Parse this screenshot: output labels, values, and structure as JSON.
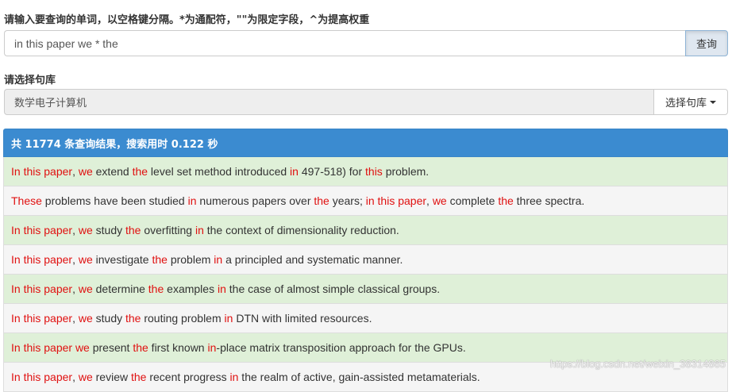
{
  "query": {
    "label": "请输入要查询的单词，以空格键分隔。*为通配符，\"\"为限定字段，^为提高权重",
    "value": "in this paper we * the",
    "button": "查询"
  },
  "corpus": {
    "label": "请选择句库",
    "selected": "数学电子计算机",
    "button": "选择句库"
  },
  "results": {
    "header": "共 11774 条查询结果，搜索用时 0.122 秒",
    "highlight_color": "#e01010",
    "success_row_color": "#dff0d8",
    "plain_row_color": "#f5f5f5",
    "rows": [
      {
        "style": "success",
        "segments": [
          {
            "t": "In this paper",
            "h": true
          },
          {
            "t": ", ",
            "h": false
          },
          {
            "t": "we",
            "h": true
          },
          {
            "t": " extend ",
            "h": false
          },
          {
            "t": "the",
            "h": true
          },
          {
            "t": " level set method introduced ",
            "h": false
          },
          {
            "t": "in",
            "h": true
          },
          {
            "t": " 497-518) for ",
            "h": false
          },
          {
            "t": "this",
            "h": true
          },
          {
            "t": " problem.",
            "h": false
          }
        ]
      },
      {
        "style": "plain",
        "segments": [
          {
            "t": "These",
            "h": true
          },
          {
            "t": " problems have been studied ",
            "h": false
          },
          {
            "t": "in",
            "h": true
          },
          {
            "t": " numerous papers over ",
            "h": false
          },
          {
            "t": "the",
            "h": true
          },
          {
            "t": " years; ",
            "h": false
          },
          {
            "t": "in this paper",
            "h": true
          },
          {
            "t": ", ",
            "h": false
          },
          {
            "t": "we",
            "h": true
          },
          {
            "t": " complete ",
            "h": false
          },
          {
            "t": "the",
            "h": true
          },
          {
            "t": " three spectra.",
            "h": false
          }
        ]
      },
      {
        "style": "success",
        "segments": [
          {
            "t": "In this paper",
            "h": true
          },
          {
            "t": ", ",
            "h": false
          },
          {
            "t": "we",
            "h": true
          },
          {
            "t": " study ",
            "h": false
          },
          {
            "t": "the",
            "h": true
          },
          {
            "t": " overfitting ",
            "h": false
          },
          {
            "t": "in",
            "h": true
          },
          {
            "t": " the context of dimensionality reduction.",
            "h": false
          }
        ]
      },
      {
        "style": "plain",
        "segments": [
          {
            "t": "In this paper",
            "h": true
          },
          {
            "t": ", ",
            "h": false
          },
          {
            "t": "we",
            "h": true
          },
          {
            "t": " investigate ",
            "h": false
          },
          {
            "t": "the",
            "h": true
          },
          {
            "t": " problem ",
            "h": false
          },
          {
            "t": "in",
            "h": true
          },
          {
            "t": " a principled and systematic manner.",
            "h": false
          }
        ]
      },
      {
        "style": "success",
        "segments": [
          {
            "t": "In this paper",
            "h": true
          },
          {
            "t": ", ",
            "h": false
          },
          {
            "t": "we",
            "h": true
          },
          {
            "t": " determine ",
            "h": false
          },
          {
            "t": "the",
            "h": true
          },
          {
            "t": " examples ",
            "h": false
          },
          {
            "t": "in",
            "h": true
          },
          {
            "t": " the case of almost simple classical groups.",
            "h": false
          }
        ]
      },
      {
        "style": "plain",
        "segments": [
          {
            "t": "In this paper",
            "h": true
          },
          {
            "t": ", ",
            "h": false
          },
          {
            "t": "we",
            "h": true
          },
          {
            "t": " study ",
            "h": false
          },
          {
            "t": "the",
            "h": true
          },
          {
            "t": " routing problem ",
            "h": false
          },
          {
            "t": "in",
            "h": true
          },
          {
            "t": " DTN with limited resources.",
            "h": false
          }
        ]
      },
      {
        "style": "success",
        "segments": [
          {
            "t": "In this paper we",
            "h": true
          },
          {
            "t": " present ",
            "h": false
          },
          {
            "t": "the",
            "h": true
          },
          {
            "t": " first known ",
            "h": false
          },
          {
            "t": "in",
            "h": true
          },
          {
            "t": "-place matrix transposition approach for the GPUs.",
            "h": false
          }
        ]
      },
      {
        "style": "plain",
        "segments": [
          {
            "t": "In this paper",
            "h": true
          },
          {
            "t": ", ",
            "h": false
          },
          {
            "t": "we",
            "h": true
          },
          {
            "t": " review ",
            "h": false
          },
          {
            "t": "the",
            "h": true
          },
          {
            "t": " recent progress ",
            "h": false
          },
          {
            "t": "in",
            "h": true
          },
          {
            "t": " the realm of active, gain-assisted metamaterials.",
            "h": false
          }
        ]
      }
    ]
  },
  "watermark": "https://blog.csdn.net/weixin_38314865"
}
